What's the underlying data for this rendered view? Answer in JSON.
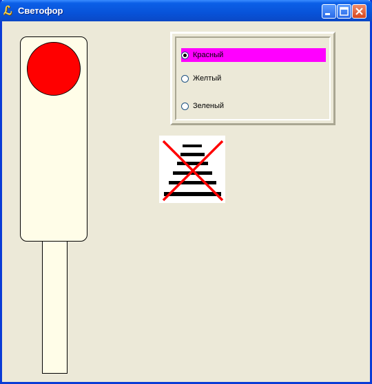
{
  "window": {
    "title": "Светофор",
    "app_icon": "delphi-icon"
  },
  "titlebar_buttons": [
    "minimize-icon",
    "maximize-icon",
    "close-icon"
  ],
  "traffic_light": {
    "lamp_color": "#ff0000",
    "housing_color": "#fffde8"
  },
  "radio_group": {
    "options": [
      {
        "label": "Красный",
        "selected": true
      },
      {
        "label": "Желтый",
        "selected": false
      },
      {
        "label": "Зеленый",
        "selected": false
      }
    ],
    "highlight_color": "#ff00ff"
  },
  "picture": {
    "icon": "broken-image-icon",
    "cross_color": "#ff0000"
  }
}
